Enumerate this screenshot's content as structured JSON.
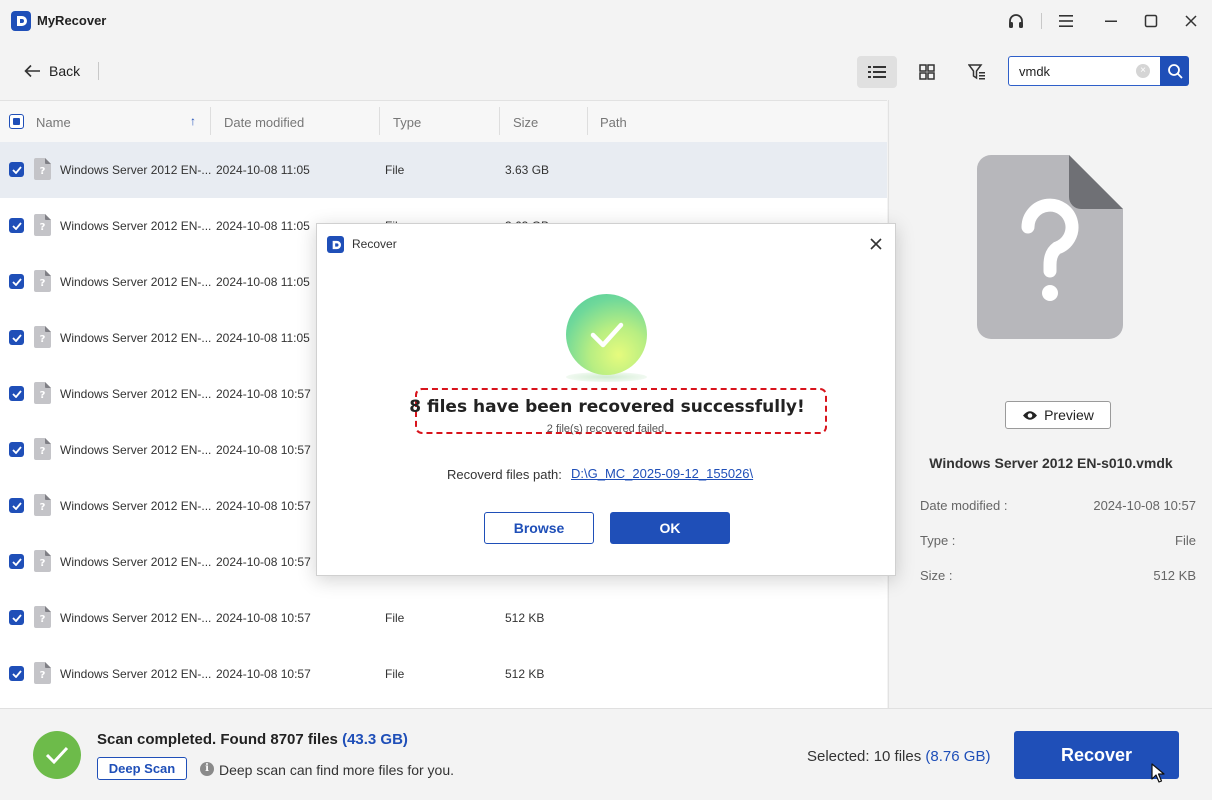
{
  "app": {
    "title": "MyRecover"
  },
  "toolbar": {
    "back_label": "Back",
    "search": {
      "value": "vmdk",
      "placeholder": ""
    }
  },
  "columns": {
    "name": "Name",
    "date": "Date modified",
    "type": "Type",
    "size": "Size",
    "path": "Path"
  },
  "rows": [
    {
      "name": "Windows Server 2012 EN-...",
      "date": "2024-10-08 11:05",
      "type": "File",
      "size": "3.63 GB",
      "path": ""
    },
    {
      "name": "Windows Server 2012 EN-...",
      "date": "2024-10-08 11:05",
      "type": "File",
      "size": "3.63 GB",
      "path": ""
    },
    {
      "name": "Windows Server 2012 EN-...",
      "date": "2024-10-08 11:05",
      "type": "",
      "size": "",
      "path": ""
    },
    {
      "name": "Windows Server 2012 EN-...",
      "date": "2024-10-08 11:05",
      "type": "",
      "size": "",
      "path": ""
    },
    {
      "name": "Windows Server 2012 EN-...",
      "date": "2024-10-08 10:57",
      "type": "",
      "size": "",
      "path": ""
    },
    {
      "name": "Windows Server 2012 EN-...",
      "date": "2024-10-08 10:57",
      "type": "",
      "size": "",
      "path": ""
    },
    {
      "name": "Windows Server 2012 EN-...",
      "date": "2024-10-08 10:57",
      "type": "",
      "size": "",
      "path": ""
    },
    {
      "name": "Windows Server 2012 EN-...",
      "date": "2024-10-08 10:57",
      "type": "",
      "size": "",
      "path": ""
    },
    {
      "name": "Windows Server 2012 EN-...",
      "date": "2024-10-08 10:57",
      "type": "File",
      "size": "512 KB",
      "path": ""
    },
    {
      "name": "Windows Server 2012 EN-...",
      "date": "2024-10-08 10:57",
      "type": "File",
      "size": "512 KB",
      "path": ""
    }
  ],
  "detail": {
    "preview_label": "Preview",
    "file_name": "Windows Server 2012 EN-s010.vmdk",
    "date_label": "Date modified :",
    "date_value": "2024-10-08 10:57",
    "type_label": "Type :",
    "type_value": "File",
    "size_label": "Size :",
    "size_value": "512 KB"
  },
  "bottom": {
    "scan_status": "Scan completed. Found 8707 files",
    "scan_size": "(43.3 GB)",
    "deep_scan_label": "Deep Scan",
    "deep_scan_hint": "Deep scan can find more files for you.",
    "selected_text": "Selected: 10 files",
    "selected_size": "(8.76 GB)",
    "recover_label": "Recover"
  },
  "dialog": {
    "title": "Recover",
    "success_message": "8 files have been recovered successfully!",
    "failed_message": "2 file(s) recovered failed.",
    "path_label": "Recoverd files path:",
    "path_value": "D:\\G_MC_2025-09-12_155026\\",
    "browse_label": "Browse",
    "ok_label": "OK"
  },
  "colors": {
    "accent": "#1f4fb8",
    "success": "#6dbb4a",
    "highlight": "#d8141c"
  },
  "icons": {
    "app_logo": "myrecover-logo-icon",
    "support": "headset-icon",
    "menu": "hamburger-menu-icon",
    "minimize": "minimize-icon",
    "maximize": "maximize-icon",
    "close": "close-icon",
    "back": "arrow-left-icon",
    "list_view": "list-view-icon",
    "grid_view": "grid-view-icon",
    "filter": "filter-icon",
    "search": "search-icon",
    "file": "unknown-file-icon",
    "eye": "eye-icon",
    "check": "checkmark-icon",
    "info": "info-icon"
  }
}
